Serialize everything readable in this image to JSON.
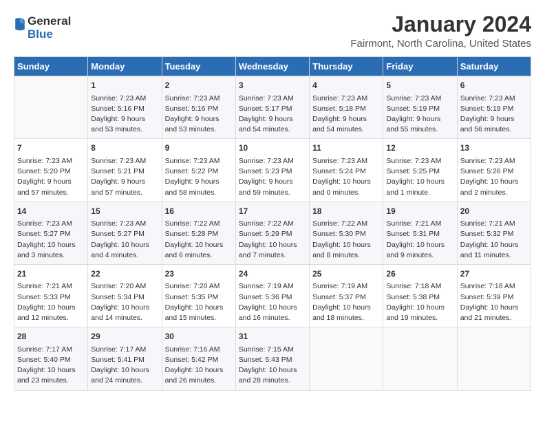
{
  "logo": {
    "general": "General",
    "blue": "Blue"
  },
  "header": {
    "title": "January 2024",
    "subtitle": "Fairmont, North Carolina, United States"
  },
  "days_of_week": [
    "Sunday",
    "Monday",
    "Tuesday",
    "Wednesday",
    "Thursday",
    "Friday",
    "Saturday"
  ],
  "weeks": [
    [
      {
        "day": "",
        "content": ""
      },
      {
        "day": "1",
        "content": "Sunrise: 7:23 AM\nSunset: 5:16 PM\nDaylight: 9 hours\nand 53 minutes."
      },
      {
        "day": "2",
        "content": "Sunrise: 7:23 AM\nSunset: 5:16 PM\nDaylight: 9 hours\nand 53 minutes."
      },
      {
        "day": "3",
        "content": "Sunrise: 7:23 AM\nSunset: 5:17 PM\nDaylight: 9 hours\nand 54 minutes."
      },
      {
        "day": "4",
        "content": "Sunrise: 7:23 AM\nSunset: 5:18 PM\nDaylight: 9 hours\nand 54 minutes."
      },
      {
        "day": "5",
        "content": "Sunrise: 7:23 AM\nSunset: 5:19 PM\nDaylight: 9 hours\nand 55 minutes."
      },
      {
        "day": "6",
        "content": "Sunrise: 7:23 AM\nSunset: 5:19 PM\nDaylight: 9 hours\nand 56 minutes."
      }
    ],
    [
      {
        "day": "7",
        "content": "Sunrise: 7:23 AM\nSunset: 5:20 PM\nDaylight: 9 hours\nand 57 minutes."
      },
      {
        "day": "8",
        "content": "Sunrise: 7:23 AM\nSunset: 5:21 PM\nDaylight: 9 hours\nand 57 minutes."
      },
      {
        "day": "9",
        "content": "Sunrise: 7:23 AM\nSunset: 5:22 PM\nDaylight: 9 hours\nand 58 minutes."
      },
      {
        "day": "10",
        "content": "Sunrise: 7:23 AM\nSunset: 5:23 PM\nDaylight: 9 hours\nand 59 minutes."
      },
      {
        "day": "11",
        "content": "Sunrise: 7:23 AM\nSunset: 5:24 PM\nDaylight: 10 hours\nand 0 minutes."
      },
      {
        "day": "12",
        "content": "Sunrise: 7:23 AM\nSunset: 5:25 PM\nDaylight: 10 hours\nand 1 minute."
      },
      {
        "day": "13",
        "content": "Sunrise: 7:23 AM\nSunset: 5:26 PM\nDaylight: 10 hours\nand 2 minutes."
      }
    ],
    [
      {
        "day": "14",
        "content": "Sunrise: 7:23 AM\nSunset: 5:27 PM\nDaylight: 10 hours\nand 3 minutes."
      },
      {
        "day": "15",
        "content": "Sunrise: 7:23 AM\nSunset: 5:27 PM\nDaylight: 10 hours\nand 4 minutes."
      },
      {
        "day": "16",
        "content": "Sunrise: 7:22 AM\nSunset: 5:28 PM\nDaylight: 10 hours\nand 6 minutes."
      },
      {
        "day": "17",
        "content": "Sunrise: 7:22 AM\nSunset: 5:29 PM\nDaylight: 10 hours\nand 7 minutes."
      },
      {
        "day": "18",
        "content": "Sunrise: 7:22 AM\nSunset: 5:30 PM\nDaylight: 10 hours\nand 8 minutes."
      },
      {
        "day": "19",
        "content": "Sunrise: 7:21 AM\nSunset: 5:31 PM\nDaylight: 10 hours\nand 9 minutes."
      },
      {
        "day": "20",
        "content": "Sunrise: 7:21 AM\nSunset: 5:32 PM\nDaylight: 10 hours\nand 11 minutes."
      }
    ],
    [
      {
        "day": "21",
        "content": "Sunrise: 7:21 AM\nSunset: 5:33 PM\nDaylight: 10 hours\nand 12 minutes."
      },
      {
        "day": "22",
        "content": "Sunrise: 7:20 AM\nSunset: 5:34 PM\nDaylight: 10 hours\nand 14 minutes."
      },
      {
        "day": "23",
        "content": "Sunrise: 7:20 AM\nSunset: 5:35 PM\nDaylight: 10 hours\nand 15 minutes."
      },
      {
        "day": "24",
        "content": "Sunrise: 7:19 AM\nSunset: 5:36 PM\nDaylight: 10 hours\nand 16 minutes."
      },
      {
        "day": "25",
        "content": "Sunrise: 7:19 AM\nSunset: 5:37 PM\nDaylight: 10 hours\nand 18 minutes."
      },
      {
        "day": "26",
        "content": "Sunrise: 7:18 AM\nSunset: 5:38 PM\nDaylight: 10 hours\nand 19 minutes."
      },
      {
        "day": "27",
        "content": "Sunrise: 7:18 AM\nSunset: 5:39 PM\nDaylight: 10 hours\nand 21 minutes."
      }
    ],
    [
      {
        "day": "28",
        "content": "Sunrise: 7:17 AM\nSunset: 5:40 PM\nDaylight: 10 hours\nand 23 minutes."
      },
      {
        "day": "29",
        "content": "Sunrise: 7:17 AM\nSunset: 5:41 PM\nDaylight: 10 hours\nand 24 minutes."
      },
      {
        "day": "30",
        "content": "Sunrise: 7:16 AM\nSunset: 5:42 PM\nDaylight: 10 hours\nand 26 minutes."
      },
      {
        "day": "31",
        "content": "Sunrise: 7:15 AM\nSunset: 5:43 PM\nDaylight: 10 hours\nand 28 minutes."
      },
      {
        "day": "",
        "content": ""
      },
      {
        "day": "",
        "content": ""
      },
      {
        "day": "",
        "content": ""
      }
    ]
  ]
}
